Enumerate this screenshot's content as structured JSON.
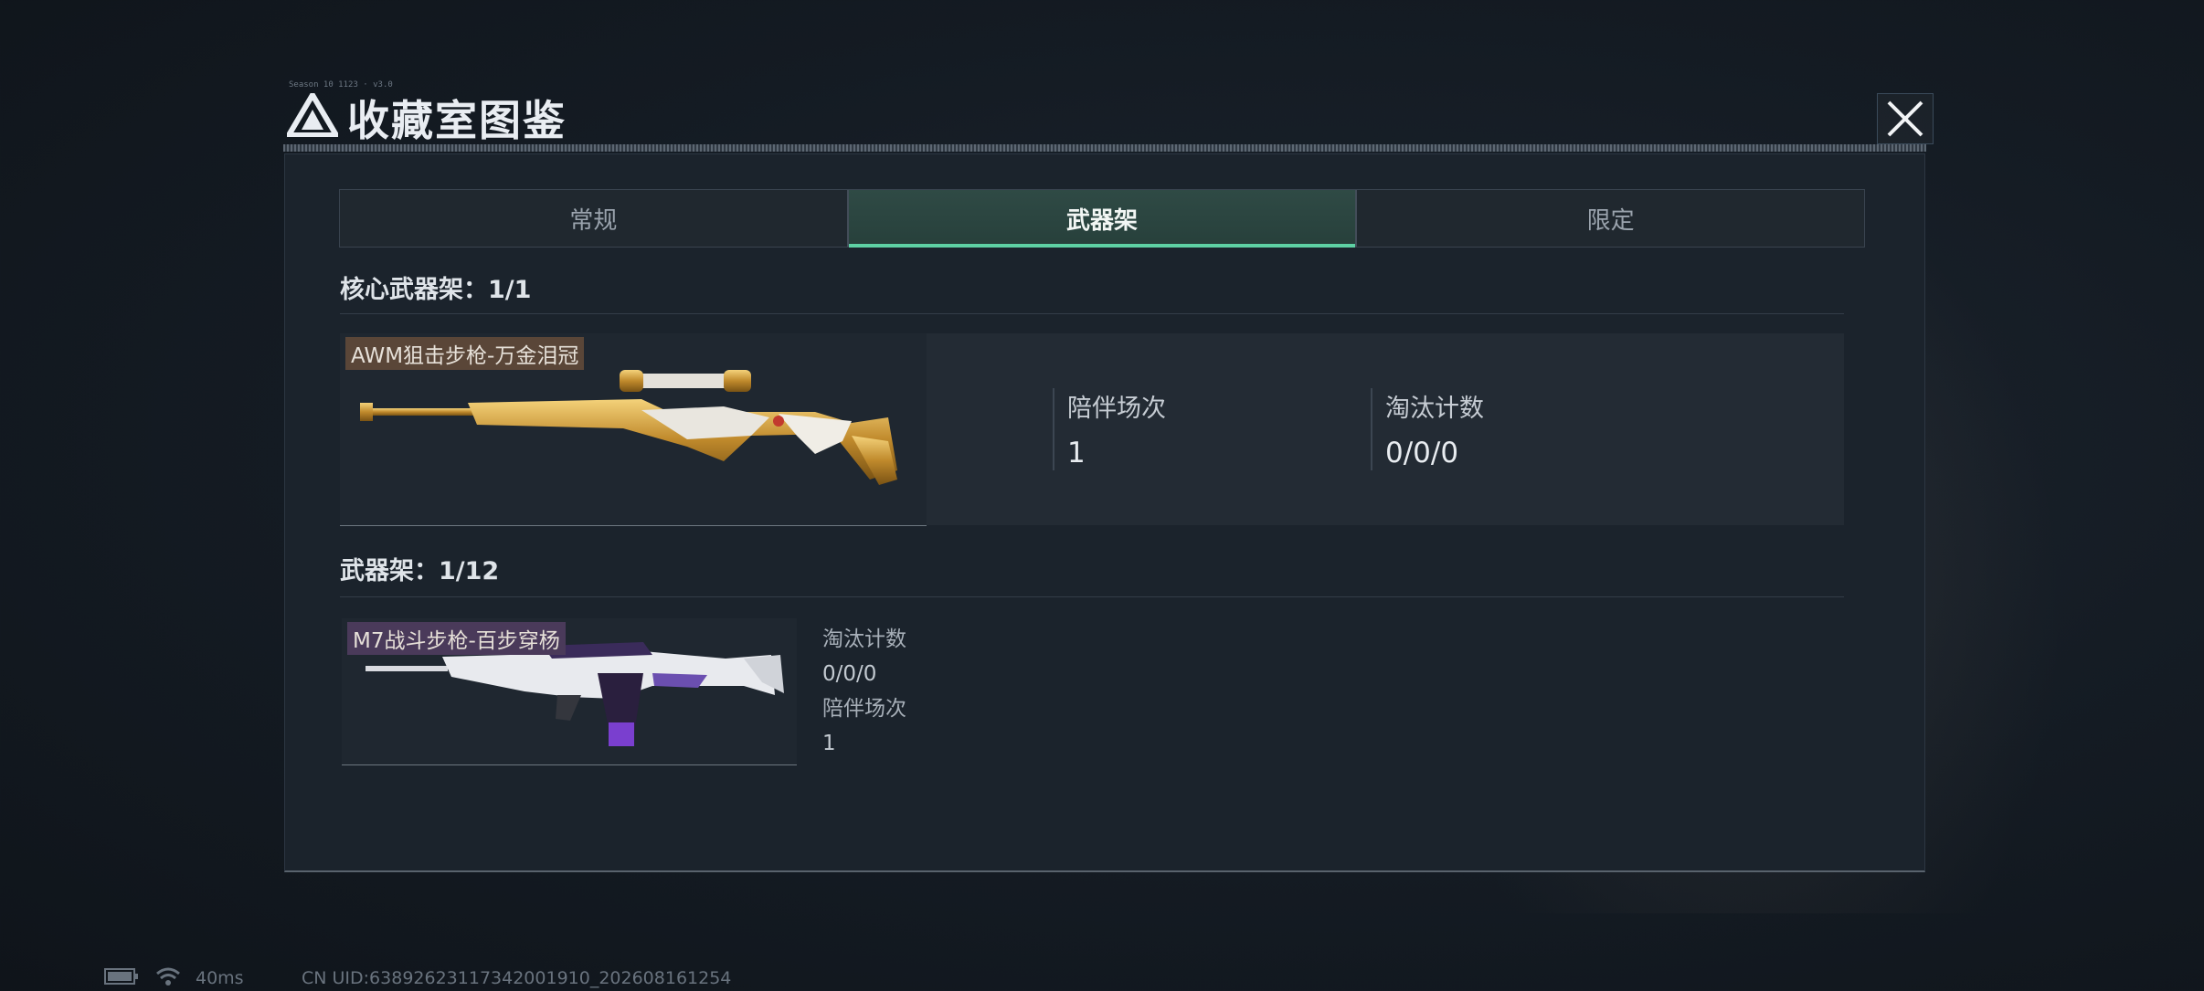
{
  "dialog": {
    "title": "收藏室图鉴",
    "title_micro": "Season 10  1123 · v3.0"
  },
  "tabs": [
    {
      "label": "常规",
      "active": false
    },
    {
      "label": "武器架",
      "active": true
    },
    {
      "label": "限定",
      "active": false
    }
  ],
  "core_rack": {
    "title": "核心武器架：1/1",
    "weapon": {
      "name": "AWM狙击步枪-万金泪冠",
      "stat1_label": "陪伴场次",
      "stat1_value": "1",
      "stat2_label": "淘汰计数",
      "stat2_value": "0/0/0"
    }
  },
  "rack": {
    "title": "武器架：1/12",
    "weapons": [
      {
        "name": "M7战斗步枪-百步穿杨",
        "stat1_label": "淘汰计数",
        "stat1_value": "0/0/0",
        "stat2_label": "陪伴场次",
        "stat2_value": "1"
      }
    ]
  },
  "status_bar": {
    "ping": "40ms",
    "uid": "CN UID:6389262311734200191​0_202608161254"
  },
  "colors": {
    "accent_tab_underline": "#5ed1a4",
    "gold_weapon_tag_bg": "#5a4638",
    "purple_weapon_tag_bg": "#4a3a5a"
  }
}
